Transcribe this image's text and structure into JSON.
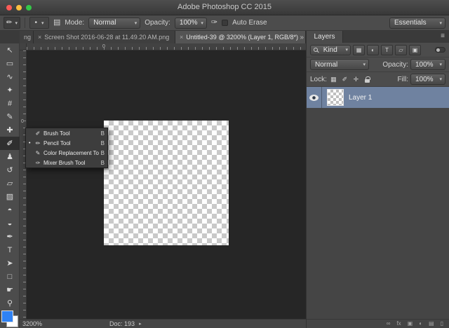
{
  "colors": {
    "selected_layer": "#6f82a0",
    "foreground_swatch": "#2f82f5",
    "traffic_close": "#fc5b57",
    "traffic_minimize": "#fdbe3f",
    "traffic_zoom": "#34c748"
  },
  "titlebar": {
    "title": "Adobe Photoshop CC 2015"
  },
  "chrome": {
    "dropdown_arrow": "▾",
    "tab_overflow": "»"
  },
  "options_bar": {
    "tool_icon_glyph": "✏",
    "brush_preset_glyph": "•",
    "panel_toggle_glyph": "▤",
    "mode_label": "Mode:",
    "mode_value": "Normal",
    "opacity_label": "Opacity:",
    "opacity_value": "100%",
    "airbrush_glyph": "✑",
    "auto_erase_label": "Auto Erase",
    "workspace_value": "Essentials"
  },
  "tabs": [
    {
      "label": "ng"
    },
    {
      "close": "×",
      "label": "Screen Shot 2016-06-28 at 11.49.20 AM.png"
    },
    {
      "close": "×",
      "label": "Untitled-39 @ 3200% (Layer 1, RGB/8*)"
    }
  ],
  "toolbar": {
    "tools": [
      {
        "name": "move-tool",
        "glyph": "↖"
      },
      {
        "name": "marquee-tool",
        "glyph": "▭"
      },
      {
        "name": "lasso-tool",
        "glyph": "∿"
      },
      {
        "name": "quick-selection-tool",
        "glyph": "✦"
      },
      {
        "name": "crop-tool",
        "glyph": "#"
      },
      {
        "name": "eyedropper-tool",
        "glyph": "✎"
      },
      {
        "name": "healing-brush-tool",
        "glyph": "✚"
      },
      {
        "name": "brush-tool",
        "glyph": "✐"
      },
      {
        "name": "clone-stamp-tool",
        "glyph": "♟"
      },
      {
        "name": "history-brush-tool",
        "glyph": "↺"
      },
      {
        "name": "eraser-tool",
        "glyph": "▱"
      },
      {
        "name": "gradient-tool",
        "glyph": "▨"
      },
      {
        "name": "blur-tool",
        "glyph": "◓"
      },
      {
        "name": "dodge-tool",
        "glyph": "◒"
      },
      {
        "name": "pen-tool",
        "glyph": "✒"
      },
      {
        "name": "type-tool",
        "glyph": "T"
      },
      {
        "name": "path-selection-tool",
        "glyph": "➤"
      },
      {
        "name": "rectangle-tool",
        "glyph": "□"
      },
      {
        "name": "hand-tool",
        "glyph": "☛"
      },
      {
        "name": "zoom-tool",
        "glyph": "⚲"
      }
    ]
  },
  "tool_flyout": {
    "current_marker": "•",
    "items": [
      {
        "glyph": "✐",
        "label": "Brush Tool",
        "shortcut": "B"
      },
      {
        "glyph": "✏",
        "label": "Pencil Tool",
        "shortcut": "B"
      },
      {
        "glyph": "✎",
        "label": "Color Replacement Tool",
        "shortcut": "B"
      },
      {
        "glyph": "✑",
        "label": "Mixer Brush Tool",
        "shortcut": "B"
      }
    ]
  },
  "rulers": {
    "zero": "0"
  },
  "layers_panel": {
    "tab_label": "Layers",
    "menu_glyph": "≡",
    "filter": {
      "kind_label": "Kind",
      "buttons": [
        {
          "name": "pixel-layers-filter",
          "glyph": "▦"
        },
        {
          "name": "adjustment-layers-filter",
          "glyph": "◐"
        },
        {
          "name": "type-layers-filter",
          "glyph": "T"
        },
        {
          "name": "shape-layers-filter",
          "glyph": "▱"
        },
        {
          "name": "smart-object-filter",
          "glyph": "▣"
        }
      ]
    },
    "blend_mode_value": "Normal",
    "opacity_label": "Opacity:",
    "opacity_value": "100%",
    "lock_label": "Lock:",
    "lock_icons": [
      {
        "name": "lock-transparent-pixels",
        "glyph": "▦"
      },
      {
        "name": "lock-image-pixels",
        "glyph": "✐"
      },
      {
        "name": "lock-position",
        "glyph": "✛"
      }
    ],
    "fill_label": "Fill:",
    "fill_value": "100%",
    "layers": [
      {
        "name": "Layer 1"
      }
    ],
    "bottom_bar": [
      {
        "name": "link-layers",
        "glyph": "∞"
      },
      {
        "name": "layer-effects",
        "glyph": "fx"
      },
      {
        "name": "layer-mask",
        "glyph": "▣"
      },
      {
        "name": "adjustment-layer",
        "glyph": "◐"
      },
      {
        "name": "new-group",
        "glyph": "▤"
      },
      {
        "name": "delete-layer",
        "glyph": "▯"
      }
    ]
  },
  "status_bar": {
    "zoom": "3200%",
    "doc_info": "Doc: 193",
    "flyout_glyph": "▸"
  }
}
